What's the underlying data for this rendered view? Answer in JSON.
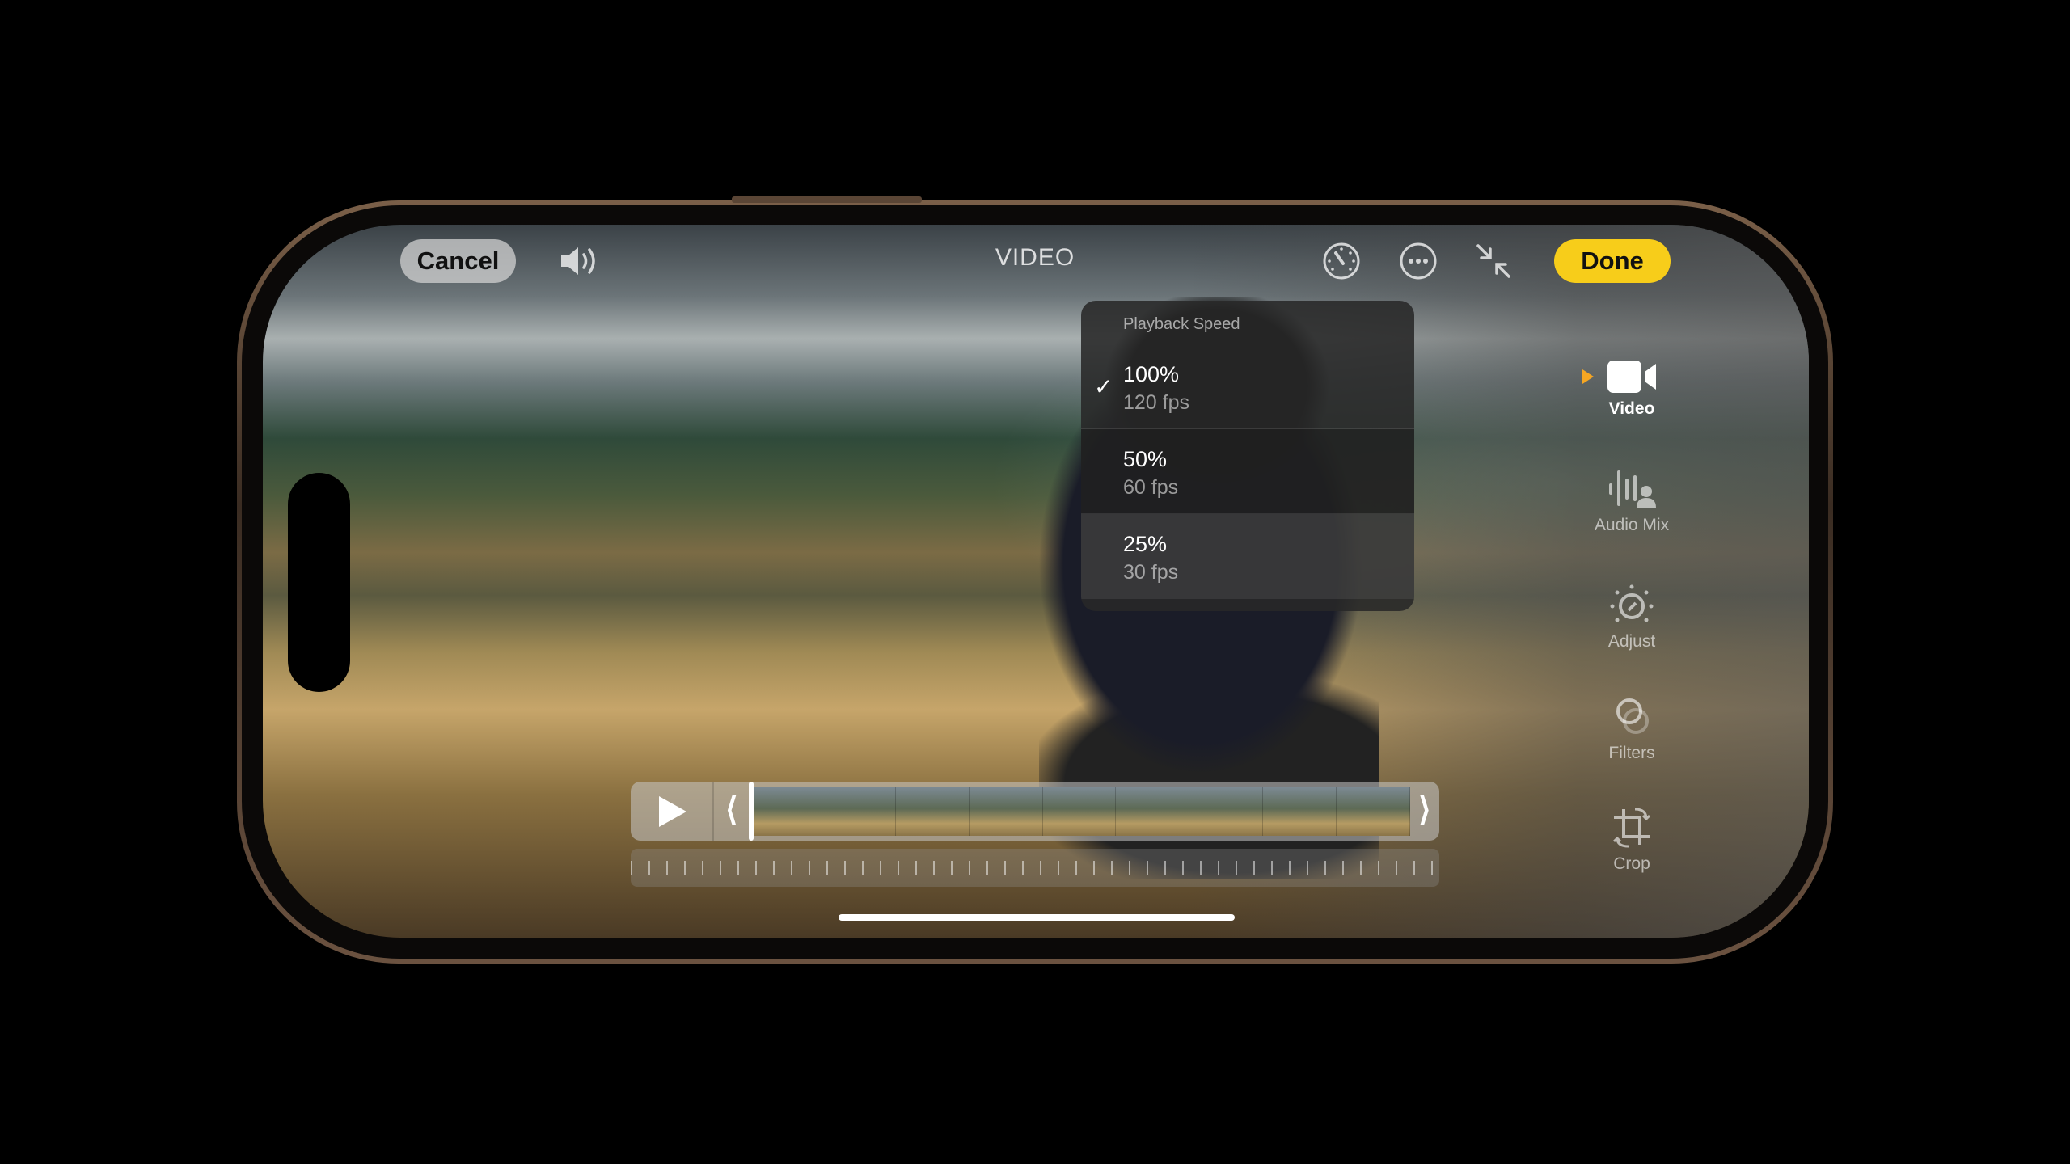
{
  "topbar": {
    "cancel_label": "Cancel",
    "title": "VIDEO",
    "done_label": "Done",
    "icons": [
      "speaker-icon",
      "playback-speed-icon",
      "more-icon",
      "collapse-icon"
    ]
  },
  "playback_menu": {
    "header": "Playback Speed",
    "items": [
      {
        "speed": "100%",
        "fps": "120 fps",
        "selected": true
      },
      {
        "speed": "50%",
        "fps": "60 fps",
        "selected": false
      },
      {
        "speed": "25%",
        "fps": "30 fps",
        "selected": false
      }
    ]
  },
  "sidebar": {
    "items": [
      {
        "label": "Video",
        "icon": "video-camera-icon",
        "active": true
      },
      {
        "label": "Audio Mix",
        "icon": "audio-mix-icon"
      },
      {
        "label": "Adjust",
        "icon": "adjust-dial-icon"
      },
      {
        "label": "Filters",
        "icon": "filters-icon"
      },
      {
        "label": "Crop",
        "icon": "crop-rotate-icon"
      }
    ]
  },
  "colors": {
    "accent": "#f7cd1a",
    "active_indicator": "#f5a623"
  }
}
